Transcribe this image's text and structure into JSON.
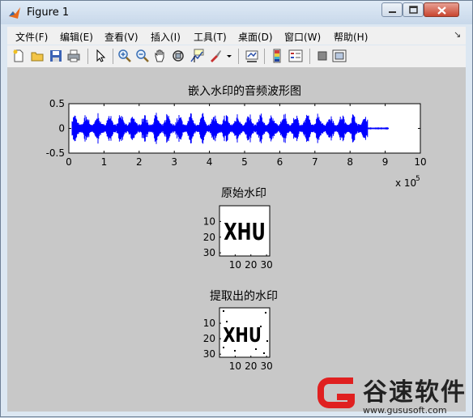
{
  "window": {
    "title": "Figure 1"
  },
  "menu": [
    "文件(F)",
    "编辑(E)",
    "查看(V)",
    "插入(I)",
    "工具(T)",
    "桌面(D)",
    "窗口(W)",
    "帮助(H)"
  ],
  "menu_overflow": "↘",
  "toolbar": [
    "new-figure-icon",
    "open-file-icon",
    "save-icon",
    "print-icon",
    "pointer-icon",
    "zoom-in-icon",
    "zoom-out-icon",
    "pan-icon",
    "rotate-3d-icon",
    "data-cursor-icon",
    "brush-icon",
    "brush-dropdown-icon",
    "link-plot-icon",
    "colorbar-icon",
    "legend-icon",
    "hide-plot-tools-icon",
    "show-plot-tools-icon"
  ],
  "chart_data": [
    {
      "type": "line",
      "title": "嵌入水印的音频波形图",
      "xlim": [
        0,
        1000000
      ],
      "ylim": [
        -0.5,
        0.5
      ],
      "x_ticks": [
        "0",
        "1",
        "2",
        "3",
        "4",
        "5",
        "6",
        "7",
        "8",
        "9",
        "10"
      ],
      "y_ticks": [
        "0.5",
        "0",
        "-0.5"
      ],
      "x_exponent_label": "x 10",
      "x_exponent_power": "5",
      "series": [
        {
          "color": "#0000ff",
          "x_end": 910000,
          "amplitude_peak": 0.35
        }
      ]
    },
    {
      "type": "heatmap",
      "title": "原始水印",
      "text_in_image": "XHU",
      "x_ticks": [
        "10",
        "20",
        "30"
      ],
      "y_ticks": [
        "10",
        "20",
        "30"
      ]
    },
    {
      "type": "heatmap",
      "title": "提取出的水印",
      "text_in_image": "XHU",
      "x_ticks": [
        "10",
        "20",
        "30"
      ],
      "y_ticks": [
        "10",
        "20",
        "30"
      ]
    }
  ],
  "watermark": {
    "name": "谷速软件",
    "url": "www.gususoft.com"
  }
}
